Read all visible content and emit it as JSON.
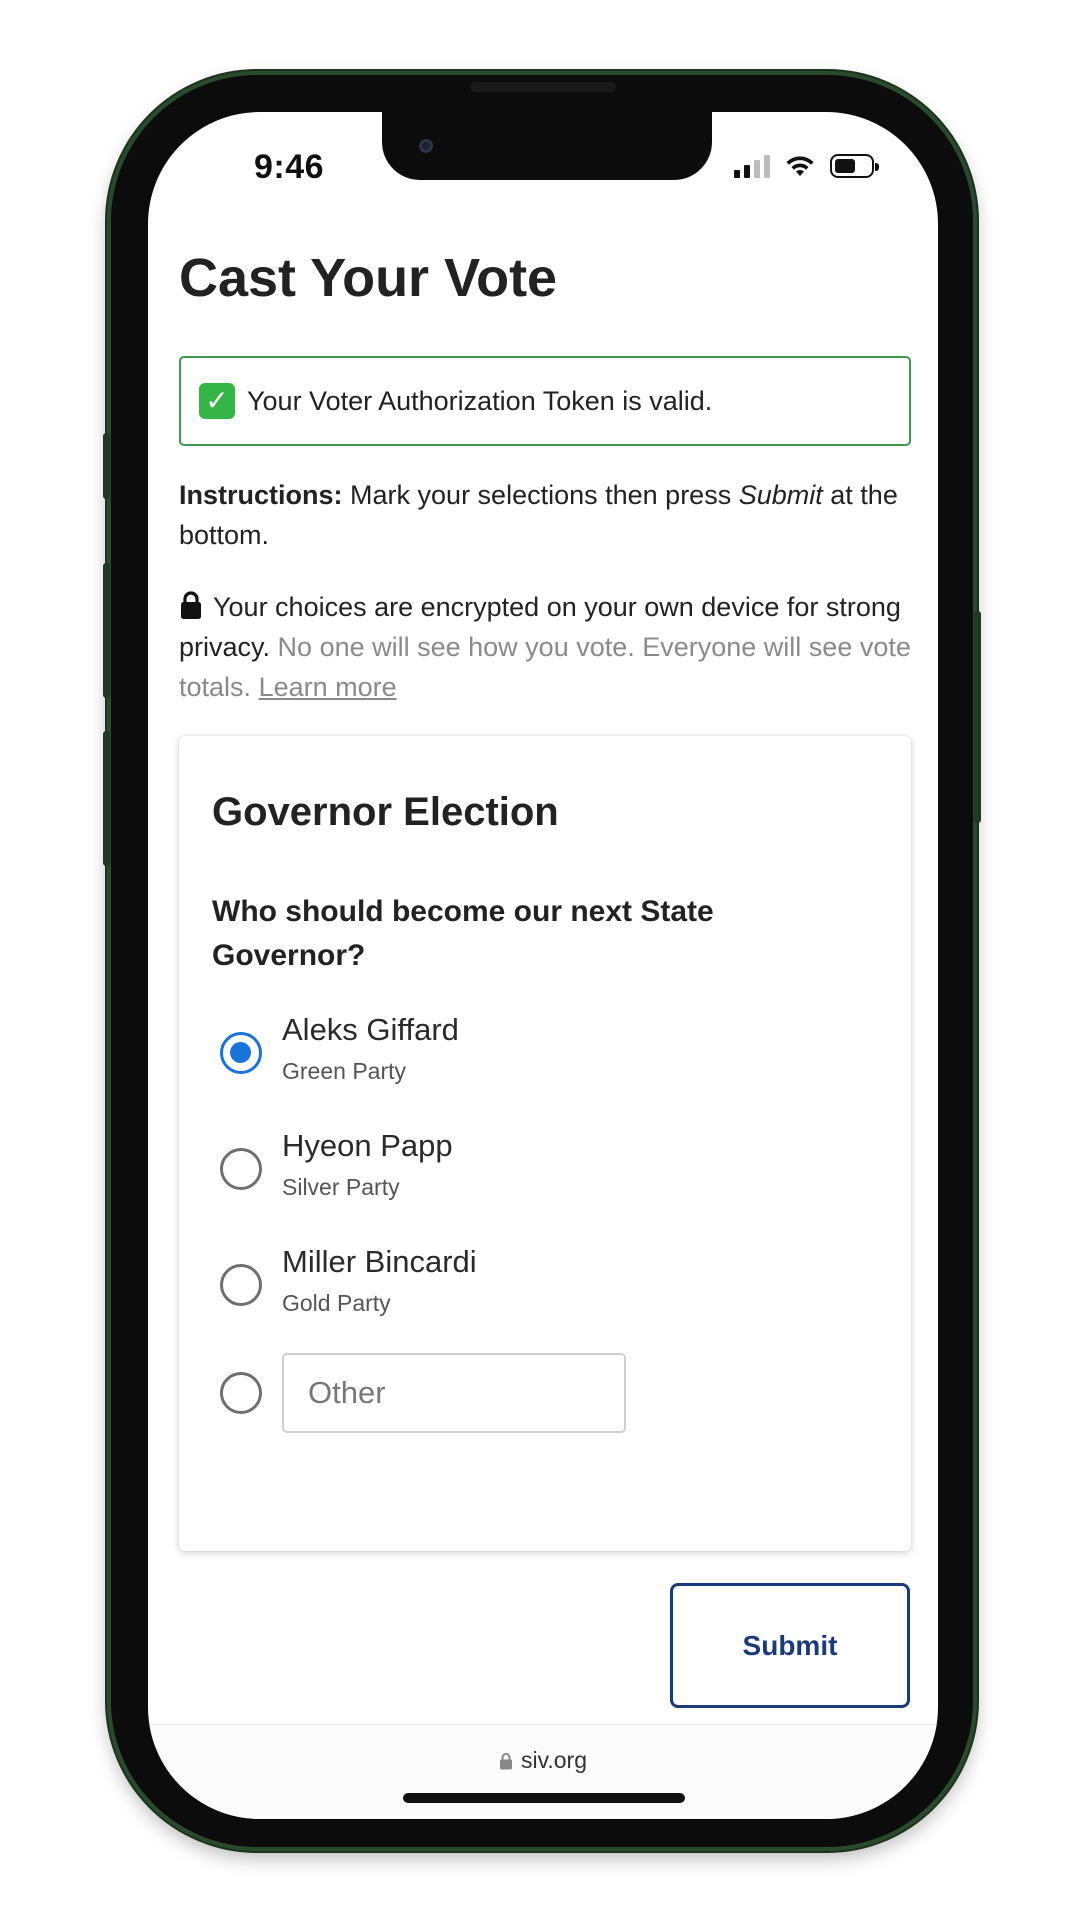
{
  "status_bar": {
    "time": "9:46",
    "icons": [
      "cellular-signal-icon",
      "wifi-icon",
      "battery-icon"
    ]
  },
  "page": {
    "title": "Cast Your Vote",
    "token_alert": {
      "icon": "check-mark-icon",
      "text": "Your Voter Authorization Token is valid."
    },
    "instructions": {
      "label": "Instructions:",
      "text_before": "Mark your selections then press",
      "emphasis": "Submit",
      "text_after": "at the bottom."
    },
    "privacy": {
      "icon": "lock-icon",
      "text_main": "Your choices are encrypted on your own device for strong privacy.",
      "text_muted": "No one will see how you vote. Everyone will see vote totals.",
      "link": "Learn more"
    }
  },
  "ballot": {
    "title": "Governor Election",
    "question": "Who should become our next State Governor?",
    "options": [
      {
        "name": "Aleks Giffard",
        "party": "Green Party",
        "selected": true
      },
      {
        "name": "Hyeon Papp",
        "party": "Silver Party",
        "selected": false
      },
      {
        "name": "Miller Bincardi",
        "party": "Gold Party",
        "selected": false
      }
    ],
    "other": {
      "placeholder": "Other",
      "value": "",
      "selected": false
    }
  },
  "submit_label": "Submit",
  "browser": {
    "url": "siv.org",
    "icon": "lock-icon"
  },
  "colors": {
    "accent_blue": "#1a73d8",
    "submit_navy": "#1b3a78",
    "valid_green": "#3c9a4b",
    "frame_green": "#2a4a2c"
  }
}
